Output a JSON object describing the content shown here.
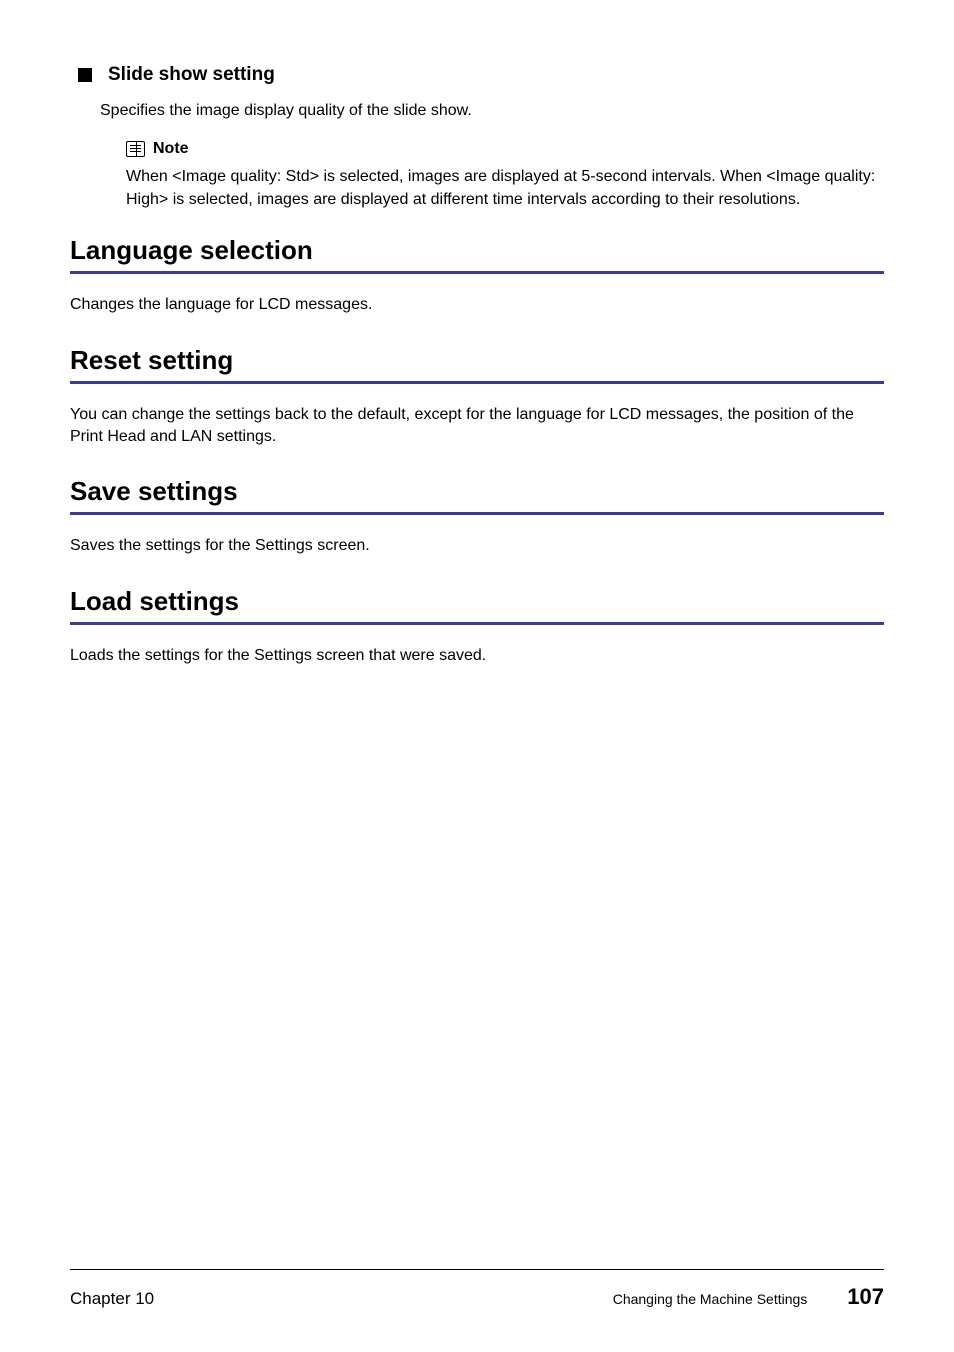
{
  "subsection": {
    "title": "Slide show setting",
    "body": "Specifies the image display quality of the slide show."
  },
  "note": {
    "label": "Note",
    "text": "When <Image quality: Std> is selected, images are displayed at 5-second intervals. When <Image quality: High> is selected, images are displayed at different time intervals according to their resolutions."
  },
  "sections": [
    {
      "heading": "Language selection",
      "body": "Changes the language for LCD messages."
    },
    {
      "heading": "Reset setting",
      "body": "You can change the settings back to the default, except for the language for LCD messages, the position of the Print Head and LAN settings."
    },
    {
      "heading": "Save settings",
      "body": "Saves the settings for the Settings screen."
    },
    {
      "heading": "Load settings",
      "body": "Loads the settings for the Settings screen that were saved."
    }
  ],
  "footer": {
    "chapter": "Chapter 10",
    "section_name": "Changing the Machine Settings",
    "page": "107"
  }
}
